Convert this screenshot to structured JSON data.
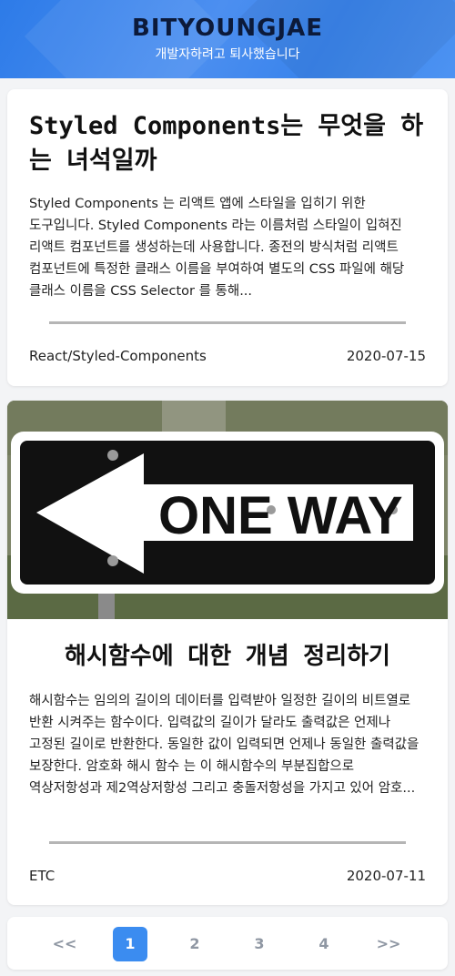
{
  "header": {
    "title": "BITYOUNGJAE",
    "subtitle": "개발자하려고 퇴사했습니다"
  },
  "posts": [
    {
      "title": "Styled Components는 무엇을 하는 녀석일까",
      "excerpt": "Styled Components 는 리액트 앱에 스타일을 입히기 위한 도구입니다. Styled Components 라는 이름처럼 스타일이 입혀진 리액트 컴포넌트를 생성하는데 사용합니다. 종전의 방식처럼 리액트 컴포넌트에 특정한 클래스 이름을 부여하여 별도의 CSS 파일에 해당 클래스 이름을 CSS Selector 를 통해...",
      "category": "React/Styled-Components",
      "date": "2020-07-15"
    },
    {
      "title": "해시함수에 대한 개념 정리하기",
      "excerpt": "해시함수는 임의의 길이의 데이터를 입력받아 일정한 길이의 비트열로 반환 시켜주는 함수이다. 입력값의 길이가 달라도 출력값은 언제나 고정된 길이로 반환한다. 동일한 값이 입력되면 언제나 동일한 출력값을 보장한다. 암호화 해시 함수 는 이 해시함수의 부분집합으로 역상저항성과 제2역상저항성 그리고 충돌저항성을 가지고 있어 암호...",
      "category": "ETC",
      "date": "2020-07-11",
      "thumbnail_sign_text": "ONE WAY"
    }
  ],
  "pagination": {
    "first": "<<",
    "pages": [
      "1",
      "2",
      "3",
      "4"
    ],
    "last": ">>",
    "active": "1"
  },
  "colors": {
    "accent": "#3b8cf0",
    "header_bg": "#3a84ec",
    "title_text": "#0c1a3a"
  }
}
